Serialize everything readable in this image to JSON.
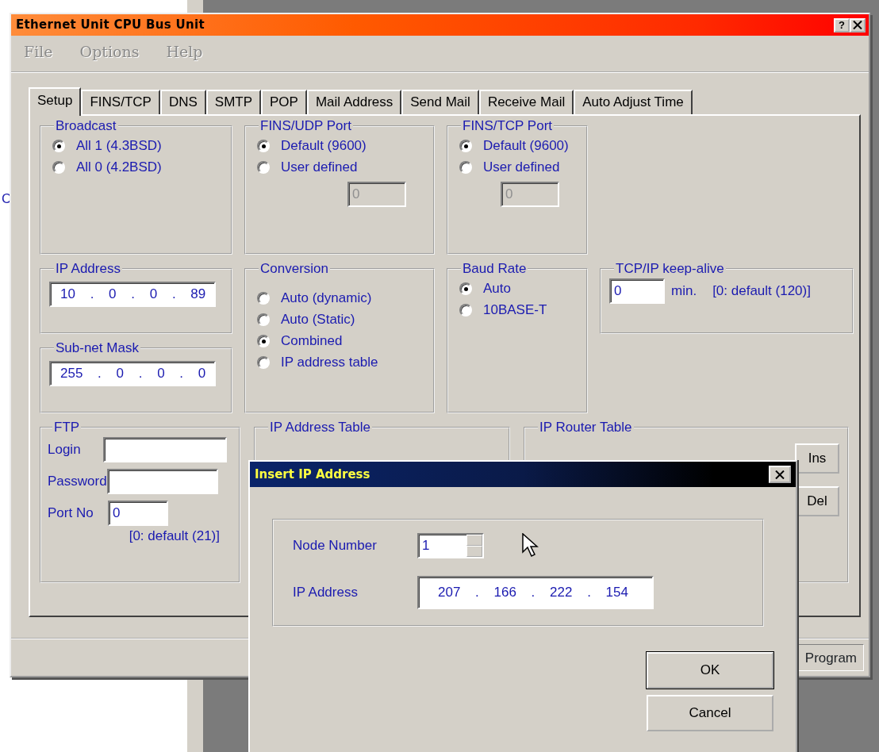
{
  "desktop_text": "C",
  "main_window": {
    "title": "Ethernet Unit CPU Bus Unit",
    "help_button": "?",
    "menu": [
      {
        "label": "File",
        "disabled": true
      },
      {
        "label": "Options",
        "disabled": true
      },
      {
        "label": "Help",
        "disabled": true
      }
    ],
    "tabs": [
      {
        "label": "Setup",
        "selected": true
      },
      {
        "label": "FINS/TCP",
        "selected": false
      },
      {
        "label": "DNS",
        "selected": false
      },
      {
        "label": "SMTP",
        "selected": false
      },
      {
        "label": "POP",
        "selected": false
      },
      {
        "label": "Mail Address",
        "selected": false
      },
      {
        "label": "Send Mail",
        "selected": false
      },
      {
        "label": "Receive Mail",
        "selected": false
      },
      {
        "label": "Auto Adjust Time",
        "selected": false
      }
    ],
    "setup": {
      "broadcast": {
        "label": "Broadcast",
        "options": [
          {
            "label": "All 1 (4.3BSD)",
            "selected": true
          },
          {
            "label": "All 0 (4.2BSD)",
            "selected": false
          }
        ]
      },
      "fins_udp_port": {
        "label": "FINS/UDP Port",
        "options": [
          {
            "label": "Default (9600)",
            "selected": true
          },
          {
            "label": "User defined",
            "selected": false
          }
        ],
        "field": {
          "value": "0",
          "disabled": true
        }
      },
      "fins_tcp_port": {
        "label": "FINS/TCP Port",
        "options": [
          {
            "label": "Default (9600)",
            "selected": true
          },
          {
            "label": "User defined",
            "selected": false
          }
        ],
        "field": {
          "value": "0",
          "disabled": true
        }
      },
      "ip_address": {
        "label": "IP Address",
        "value": "10 . 0 . 0 . 89"
      },
      "subnet_mask": {
        "label": "Sub-net Mask",
        "value": "255 . 0 . 0 . 0"
      },
      "conversion": {
        "label": "Conversion",
        "options": [
          {
            "label": "Auto (dynamic)",
            "selected": false
          },
          {
            "label": "Auto (Static)",
            "selected": false
          },
          {
            "label": "Combined",
            "selected": true
          },
          {
            "label": "IP address table",
            "selected": false
          }
        ]
      },
      "baud_rate": {
        "label": "Baud Rate",
        "options": [
          {
            "label": "Auto",
            "selected": true
          },
          {
            "label": "10BASE-T",
            "selected": false
          }
        ]
      },
      "keep_alive": {
        "label": "TCP/IP keep-alive",
        "value": "0",
        "unit": "min.",
        "hint": "[0: default (120)]"
      },
      "ftp": {
        "label": "FTP",
        "login": {
          "label": "Login"
        },
        "password": {
          "label": "Password"
        },
        "port": {
          "label": "Port No",
          "value": "0"
        },
        "hint": "[0: default (21)]"
      },
      "ip_address_table": {
        "label": "IP Address Table"
      },
      "ip_router_table": {
        "label": "IP Router Table",
        "buttons": [
          "Ins",
          "Del"
        ]
      }
    },
    "status_bar": {
      "mode": "Program"
    }
  },
  "dialog": {
    "title": "Insert IP Address",
    "node_number": {
      "label": "Node Number",
      "value": "1"
    },
    "ip_address": {
      "label": "IP Address",
      "value": "207 . 166 . 222 . 154"
    },
    "buttons": [
      {
        "label": "OK",
        "default": true
      },
      {
        "label": "Cancel",
        "default": false
      }
    ]
  }
}
